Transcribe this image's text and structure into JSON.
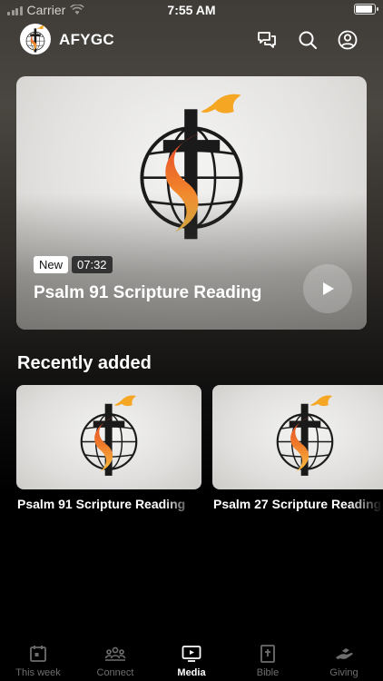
{
  "status_bar": {
    "carrier": "Carrier",
    "time": "7:55 AM"
  },
  "header": {
    "app_name": "AFYGC",
    "icons": [
      "chat-icon",
      "search-icon",
      "account-icon"
    ]
  },
  "featured": {
    "badge": "New",
    "duration": "07:32",
    "title": "Psalm 91 Scripture Reading"
  },
  "recently_added": {
    "heading": "Recently added",
    "items": [
      {
        "title": "Psalm 91 Scripture Reading"
      },
      {
        "title": "Psalm 27 Scripture Reading"
      }
    ]
  },
  "tab_bar": {
    "items": [
      {
        "label": "This week",
        "icon": "calendar-icon"
      },
      {
        "label": "Connect",
        "icon": "people-icon"
      },
      {
        "label": "Media",
        "icon": "tv-icon"
      },
      {
        "label": "Bible",
        "icon": "bible-icon"
      },
      {
        "label": "Giving",
        "icon": "giving-hand-icon"
      }
    ],
    "active": "Media"
  },
  "colors": {
    "accent_orange": "#f5a623",
    "flame_red": "#e2452c",
    "inactive_tab": "#6e6e6e"
  }
}
